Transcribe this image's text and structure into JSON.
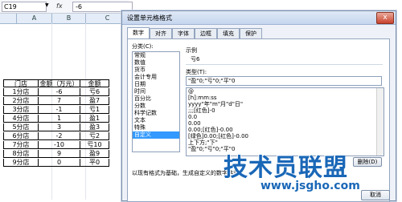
{
  "formula_bar": {
    "name_box": "C19",
    "fx": "fx",
    "value": "-6"
  },
  "sheet": {
    "col_headers": [
      "A",
      "B",
      "C"
    ],
    "table_headers": [
      "门店",
      "金额（万元）",
      "金额"
    ],
    "rows": [
      [
        "1分店",
        "-6",
        "亏6"
      ],
      [
        "2分店",
        "7",
        "盈7"
      ],
      [
        "3分店",
        "-1",
        "亏1"
      ],
      [
        "4分店",
        "1",
        "盈1"
      ],
      [
        "5分店",
        "3",
        "盈3"
      ],
      [
        "6分店",
        "-2",
        "亏2"
      ],
      [
        "7分店",
        "-10",
        "亏10"
      ],
      [
        "8分店",
        "9",
        "盈9"
      ],
      [
        "9分店",
        "0",
        "平0"
      ]
    ]
  },
  "dialog": {
    "title": "设置单元格格式",
    "close_label": "x",
    "tabs": [
      "数字",
      "对齐",
      "字体",
      "边框",
      "填充",
      "保护"
    ],
    "category_label": "分类(C):",
    "categories": [
      "常规",
      "数值",
      "货币",
      "会计专用",
      "日期",
      "时间",
      "百分比",
      "分数",
      "科学记数",
      "文本",
      "特殊",
      "自定义"
    ],
    "selected_category": "自定义",
    "sample_label": "示例",
    "sample_value": "亏6",
    "type_label": "类型(T):",
    "type_value": "\"盈\"0;\"亏\"0;\"平\"0",
    "format_list": [
      "@",
      "[h]:mm:ss",
      "yyyy\"年\"m\"月\"d\"日\"",
      ";;;[红色]-0",
      "0.0",
      "0.00",
      "0.00;[红色]-0.00",
      "[绿色]0.00;[红色]-0.00",
      "上下方;\"下\"",
      "\"盈\"0;\"亏\"0;\"平\"0"
    ],
    "delete_button": "删除(D)",
    "hint": "以现有格式为基础，生成自定义的数字格式。",
    "cancel_button": "取消"
  },
  "watermark": {
    "title": "技术员联盟",
    "url": "www.jsgho.com"
  }
}
